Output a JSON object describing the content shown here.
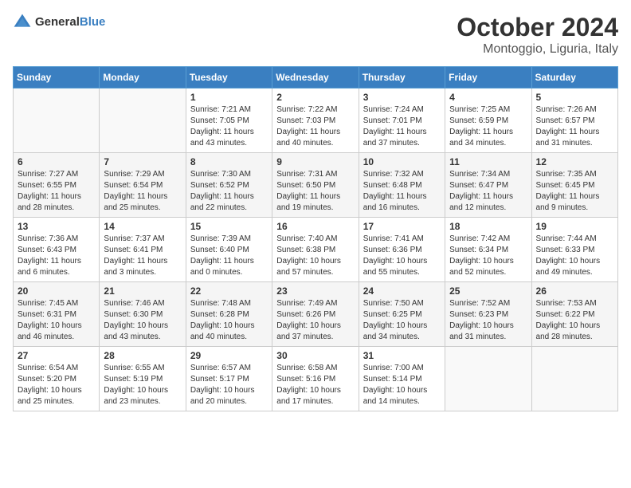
{
  "header": {
    "logo_general": "General",
    "logo_blue": "Blue",
    "month": "October 2024",
    "location": "Montoggio, Liguria, Italy"
  },
  "weekdays": [
    "Sunday",
    "Monday",
    "Tuesday",
    "Wednesday",
    "Thursday",
    "Friday",
    "Saturday"
  ],
  "weeks": [
    [
      {
        "day": "",
        "info": ""
      },
      {
        "day": "",
        "info": ""
      },
      {
        "day": "1",
        "info": "Sunrise: 7:21 AM\nSunset: 7:05 PM\nDaylight: 11 hours\nand 43 minutes."
      },
      {
        "day": "2",
        "info": "Sunrise: 7:22 AM\nSunset: 7:03 PM\nDaylight: 11 hours\nand 40 minutes."
      },
      {
        "day": "3",
        "info": "Sunrise: 7:24 AM\nSunset: 7:01 PM\nDaylight: 11 hours\nand 37 minutes."
      },
      {
        "day": "4",
        "info": "Sunrise: 7:25 AM\nSunset: 6:59 PM\nDaylight: 11 hours\nand 34 minutes."
      },
      {
        "day": "5",
        "info": "Sunrise: 7:26 AM\nSunset: 6:57 PM\nDaylight: 11 hours\nand 31 minutes."
      }
    ],
    [
      {
        "day": "6",
        "info": "Sunrise: 7:27 AM\nSunset: 6:55 PM\nDaylight: 11 hours\nand 28 minutes."
      },
      {
        "day": "7",
        "info": "Sunrise: 7:29 AM\nSunset: 6:54 PM\nDaylight: 11 hours\nand 25 minutes."
      },
      {
        "day": "8",
        "info": "Sunrise: 7:30 AM\nSunset: 6:52 PM\nDaylight: 11 hours\nand 22 minutes."
      },
      {
        "day": "9",
        "info": "Sunrise: 7:31 AM\nSunset: 6:50 PM\nDaylight: 11 hours\nand 19 minutes."
      },
      {
        "day": "10",
        "info": "Sunrise: 7:32 AM\nSunset: 6:48 PM\nDaylight: 11 hours\nand 16 minutes."
      },
      {
        "day": "11",
        "info": "Sunrise: 7:34 AM\nSunset: 6:47 PM\nDaylight: 11 hours\nand 12 minutes."
      },
      {
        "day": "12",
        "info": "Sunrise: 7:35 AM\nSunset: 6:45 PM\nDaylight: 11 hours\nand 9 minutes."
      }
    ],
    [
      {
        "day": "13",
        "info": "Sunrise: 7:36 AM\nSunset: 6:43 PM\nDaylight: 11 hours\nand 6 minutes."
      },
      {
        "day": "14",
        "info": "Sunrise: 7:37 AM\nSunset: 6:41 PM\nDaylight: 11 hours\nand 3 minutes."
      },
      {
        "day": "15",
        "info": "Sunrise: 7:39 AM\nSunset: 6:40 PM\nDaylight: 11 hours\nand 0 minutes."
      },
      {
        "day": "16",
        "info": "Sunrise: 7:40 AM\nSunset: 6:38 PM\nDaylight: 10 hours\nand 57 minutes."
      },
      {
        "day": "17",
        "info": "Sunrise: 7:41 AM\nSunset: 6:36 PM\nDaylight: 10 hours\nand 55 minutes."
      },
      {
        "day": "18",
        "info": "Sunrise: 7:42 AM\nSunset: 6:34 PM\nDaylight: 10 hours\nand 52 minutes."
      },
      {
        "day": "19",
        "info": "Sunrise: 7:44 AM\nSunset: 6:33 PM\nDaylight: 10 hours\nand 49 minutes."
      }
    ],
    [
      {
        "day": "20",
        "info": "Sunrise: 7:45 AM\nSunset: 6:31 PM\nDaylight: 10 hours\nand 46 minutes."
      },
      {
        "day": "21",
        "info": "Sunrise: 7:46 AM\nSunset: 6:30 PM\nDaylight: 10 hours\nand 43 minutes."
      },
      {
        "day": "22",
        "info": "Sunrise: 7:48 AM\nSunset: 6:28 PM\nDaylight: 10 hours\nand 40 minutes."
      },
      {
        "day": "23",
        "info": "Sunrise: 7:49 AM\nSunset: 6:26 PM\nDaylight: 10 hours\nand 37 minutes."
      },
      {
        "day": "24",
        "info": "Sunrise: 7:50 AM\nSunset: 6:25 PM\nDaylight: 10 hours\nand 34 minutes."
      },
      {
        "day": "25",
        "info": "Sunrise: 7:52 AM\nSunset: 6:23 PM\nDaylight: 10 hours\nand 31 minutes."
      },
      {
        "day": "26",
        "info": "Sunrise: 7:53 AM\nSunset: 6:22 PM\nDaylight: 10 hours\nand 28 minutes."
      }
    ],
    [
      {
        "day": "27",
        "info": "Sunrise: 6:54 AM\nSunset: 5:20 PM\nDaylight: 10 hours\nand 25 minutes."
      },
      {
        "day": "28",
        "info": "Sunrise: 6:55 AM\nSunset: 5:19 PM\nDaylight: 10 hours\nand 23 minutes."
      },
      {
        "day": "29",
        "info": "Sunrise: 6:57 AM\nSunset: 5:17 PM\nDaylight: 10 hours\nand 20 minutes."
      },
      {
        "day": "30",
        "info": "Sunrise: 6:58 AM\nSunset: 5:16 PM\nDaylight: 10 hours\nand 17 minutes."
      },
      {
        "day": "31",
        "info": "Sunrise: 7:00 AM\nSunset: 5:14 PM\nDaylight: 10 hours\nand 14 minutes."
      },
      {
        "day": "",
        "info": ""
      },
      {
        "day": "",
        "info": ""
      }
    ]
  ]
}
